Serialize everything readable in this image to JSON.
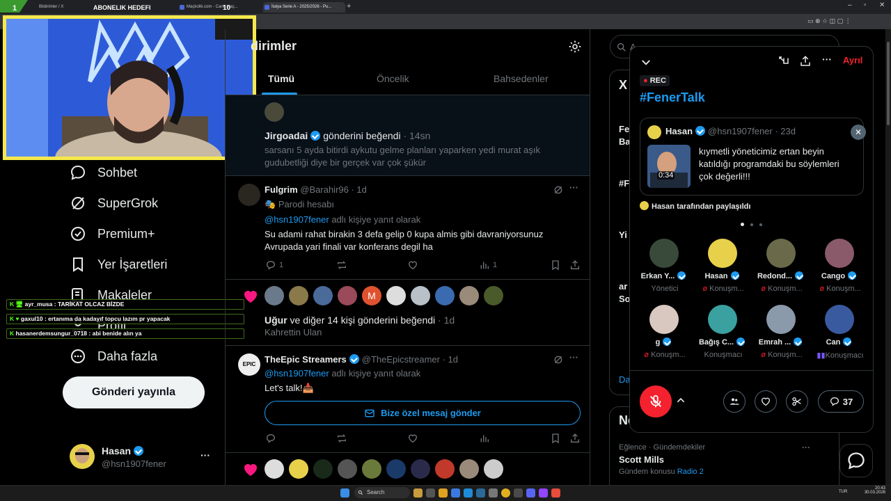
{
  "browser": {
    "tabs": [
      {
        "label": "Bildirimler / X"
      },
      {
        "label": "Maçkolik.com - Canlı maç..."
      },
      {
        "label": "İtalya Serie A - 2025/2026 - Pu..."
      }
    ],
    "tab_add": "+"
  },
  "stream_overlay": {
    "corner_number": "1",
    "subscriber_goal_label": "ABONELIK HEDEFI",
    "subscriber_goal_value": "10",
    "chat": [
      {
        "user": "ayr_musa",
        "message": "TARİKAT OLCAZ BİZDE"
      },
      {
        "user": "gaxul10",
        "message": "ertanıma da kadayıf topcu lazım pr yapacak"
      },
      {
        "user": "hasanerdemsungur_0718",
        "message": "abi benide alın ya"
      }
    ]
  },
  "left_nav": {
    "items": [
      {
        "label": "Sohbet",
        "icon": "chat-bubble-icon"
      },
      {
        "label": "SuperGrok",
        "icon": "grok-icon"
      },
      {
        "label": "Premium+",
        "icon": "verified-badge-icon"
      },
      {
        "label": "Yer İşaretleri",
        "icon": "bookmark-icon"
      },
      {
        "label": "Makaleler",
        "icon": "article-icon"
      },
      {
        "label": "Profil",
        "icon": "person-icon"
      },
      {
        "label": "Daha fazla",
        "icon": "more-circle-icon"
      }
    ],
    "post_button": "Gönderi yayınla",
    "profile": {
      "name": "Hasan",
      "handle": "@hsn1907fener",
      "more": "···"
    }
  },
  "main": {
    "title": "dirimler",
    "tabs": [
      {
        "label": "Tümü",
        "active": true
      },
      {
        "label": "Öncelik",
        "active": false
      },
      {
        "label": "Bahsedenler",
        "active": false
      }
    ],
    "notif1": {
      "user": "Jirgoadai",
      "action": "gönderini beğendi",
      "time": "· 14sn",
      "text_line1": "sarsanı 5 ayda bitirdi aykutu gelme planları yaparken yedi murat aşık",
      "text_line2": "gudubetliği diye bir gerçek var çok şükür"
    },
    "reply1": {
      "name": "Fulgrim",
      "handle": "@Barahir96 · 1d",
      "parody": "Parodi hesabı",
      "mention": "@hsn1907fener",
      "reply_suffix": " adlı kişiye yanıt olarak",
      "text_line1": "Su adami rahat birakin 3 defa gelip 0 kupa almis gibi davraniyorsunuz",
      "text_line2": "Avrupada yari finali var konferans degil ha",
      "replies": "1",
      "views": "1",
      "more": "···"
    },
    "likes2": {
      "user": "Uğur",
      "action": " ve diğer 14 kişi gönderini beğendi",
      "time": "· 1d",
      "sub": "Kahrettin Ulan",
      "m_avatar": "M"
    },
    "reply2": {
      "name": "TheEpic Streamers",
      "handle": "@TheEpicstreamer · 1d",
      "mention": "@hsn1907fener",
      "reply_suffix": " adlı kişiye yanıt olarak",
      "text": "Let's talk!📥",
      "dm_button": "Bize özel mesaj gönder",
      "more": "···"
    }
  },
  "right_column": {
    "search_placeholder": "A",
    "trend_section_top": "X",
    "partial_items": [
      "Fe",
      "Ba",
      "#F",
      "Yi",
      "ar",
      "So",
      "Da"
    ],
    "news_title": "Ne",
    "trend": {
      "category": "Eğlence · Gündemdekiler",
      "title": "Scott Mills",
      "sub_prefix": "Gündem konusu ",
      "sub_link": "Radio 2",
      "more": "···"
    }
  },
  "spaces": {
    "leave": "Ayrıl",
    "rec": "REC",
    "title": "#FenerTalk",
    "shared_post": {
      "name": "Hasan",
      "handle": "@hsn1907fener · 23d",
      "video_duration": "0:34",
      "text_line1": "kıymetli yöneticimiz ertan beyin",
      "text_line2": "katıldığı programdaki bu söylemleri",
      "text_line3": "çok değerli!!!"
    },
    "shared_by": "Hasan tarafından paylaşıldı",
    "participants": [
      {
        "name": "Erkan Y...",
        "role": "Yönetici",
        "muted": false,
        "verified": true
      },
      {
        "name": "Hasan",
        "role": "Konuşm...",
        "muted": true,
        "verified": true
      },
      {
        "name": "Redond...",
        "role": "Konuşm...",
        "muted": true,
        "verified": true
      },
      {
        "name": "Cango",
        "role": "Konuşm...",
        "muted": true,
        "verified": true
      },
      {
        "name": "g",
        "role": "Konuşm...",
        "muted": true,
        "verified": true
      },
      {
        "name": "Bağış C...",
        "role": "Konuşmacı",
        "muted": false,
        "verified": true
      },
      {
        "name": "Emrah ...",
        "role": "Konuşm...",
        "muted": true,
        "verified": true
      },
      {
        "name": "Can",
        "role": "Konuşmacı",
        "muted": false,
        "speaking": true,
        "verified": true
      }
    ],
    "comment_count": "37"
  },
  "taskbar": {
    "search_placeholder": "Search",
    "lang": "TUR",
    "time": "20:43",
    "date": "30.03.2026"
  },
  "colors": {
    "accent_blue": "#1d9bf0",
    "like_pink": "#f91880",
    "mic_red": "#f4212e",
    "webcam_border": "#f5e84c",
    "chat_green": "#3f6e1d"
  }
}
